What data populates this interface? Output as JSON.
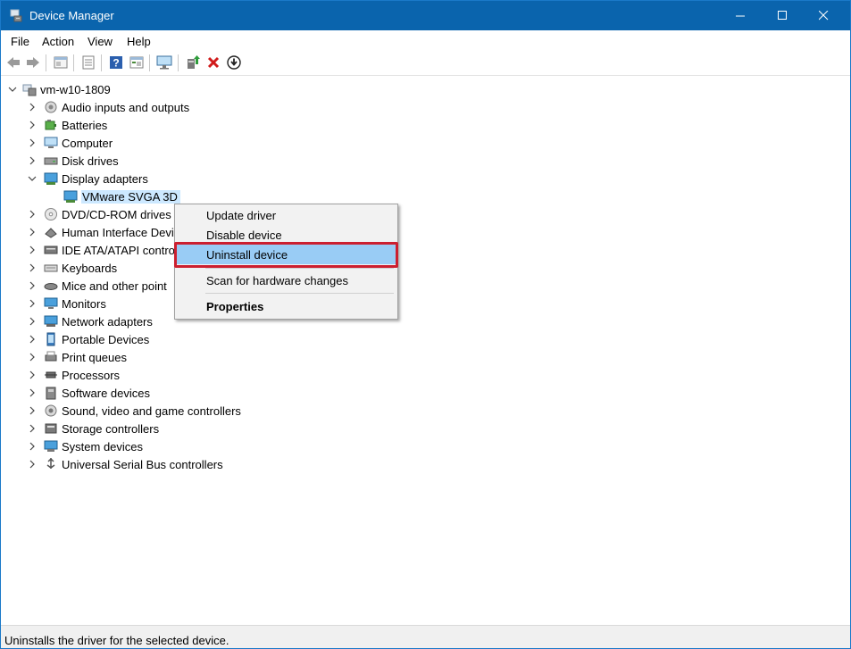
{
  "window": {
    "title": "Device Manager"
  },
  "menu": [
    "File",
    "Action",
    "View",
    "Help"
  ],
  "toolbar": [
    "back-arrow-icon",
    "forward-arrow-icon",
    "properties-icon",
    "show-hide-icon",
    "help-icon",
    "view-icon",
    "monitor-icon",
    "update-driver-icon",
    "uninstall-icon",
    "download-icon"
  ],
  "tree": {
    "root": "vm-w10-1809",
    "categories": [
      "Audio inputs and outputs",
      "Batteries",
      "Computer",
      "Disk drives",
      "Display adapters",
      "DVD/CD-ROM drives",
      "Human Interface Devi",
      "IDE ATA/ATAPI contro",
      "Keyboards",
      "Mice and other point",
      "Monitors",
      "Network adapters",
      "Portable Devices",
      "Print queues",
      "Processors",
      "Software devices",
      "Sound, video and game controllers",
      "Storage controllers",
      "System devices",
      "Universal Serial Bus controllers"
    ],
    "expanded_child": "VMware SVGA 3D"
  },
  "context_menu": {
    "items": [
      "Update driver",
      "Disable device",
      "Uninstall device",
      "Scan for hardware changes",
      "Properties"
    ],
    "highlighted": "Uninstall device"
  },
  "status": {
    "text": "Uninstalls the driver for the selected device."
  },
  "colors": {
    "titlebar": "#0a64ad",
    "selection": "#cce8ff",
    "menu_highlight": "#99ccf5",
    "annotation": "#cc1f2f"
  }
}
